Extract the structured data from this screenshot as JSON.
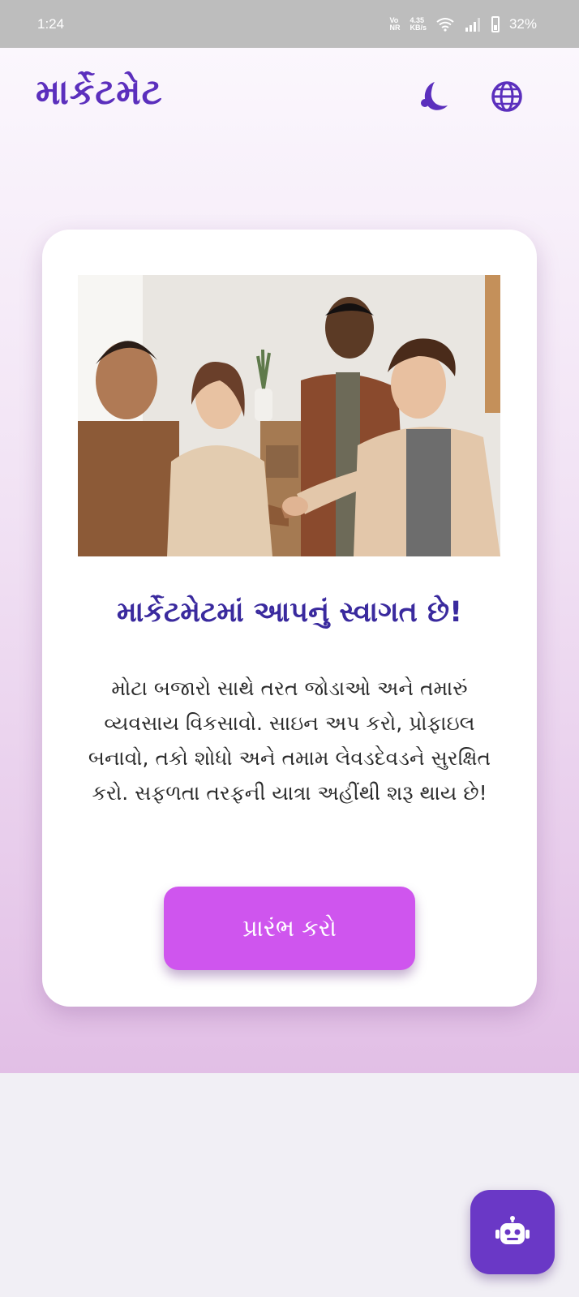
{
  "status": {
    "time": "1:24",
    "volte_top": "Vo",
    "volte_bottom": "NR",
    "speed_top": "4.35",
    "speed_bottom": "KB/s",
    "battery": "32%"
  },
  "header": {
    "brand": "માર્કેટમેટ",
    "icons": [
      "moon-icon",
      "globe-icon"
    ]
  },
  "welcome": {
    "title": "માર્કેટમેટમાં આપનું સ્વાગત છે!",
    "description": "મોટા બજારો સાથે તરત જોડાઓ અને તમારું વ્યવસાય વિકસાવો. સાઇન અપ કરો, પ્રોફાઇલ બનાવો, તકો શોધો અને તમામ લેવડદેવડને સુરક્ષિત કરો. સફળતા તરફની યાત્રા અહીંથી શરૂ થાય છે!",
    "cta_label": "પ્રારંભ કરો"
  },
  "fab": {
    "icon": "robot-icon"
  },
  "colors": {
    "brand": "#5b2fbd",
    "title": "#3a2a9e",
    "cta": "#cf55ee",
    "fab": "#6a38c6"
  }
}
